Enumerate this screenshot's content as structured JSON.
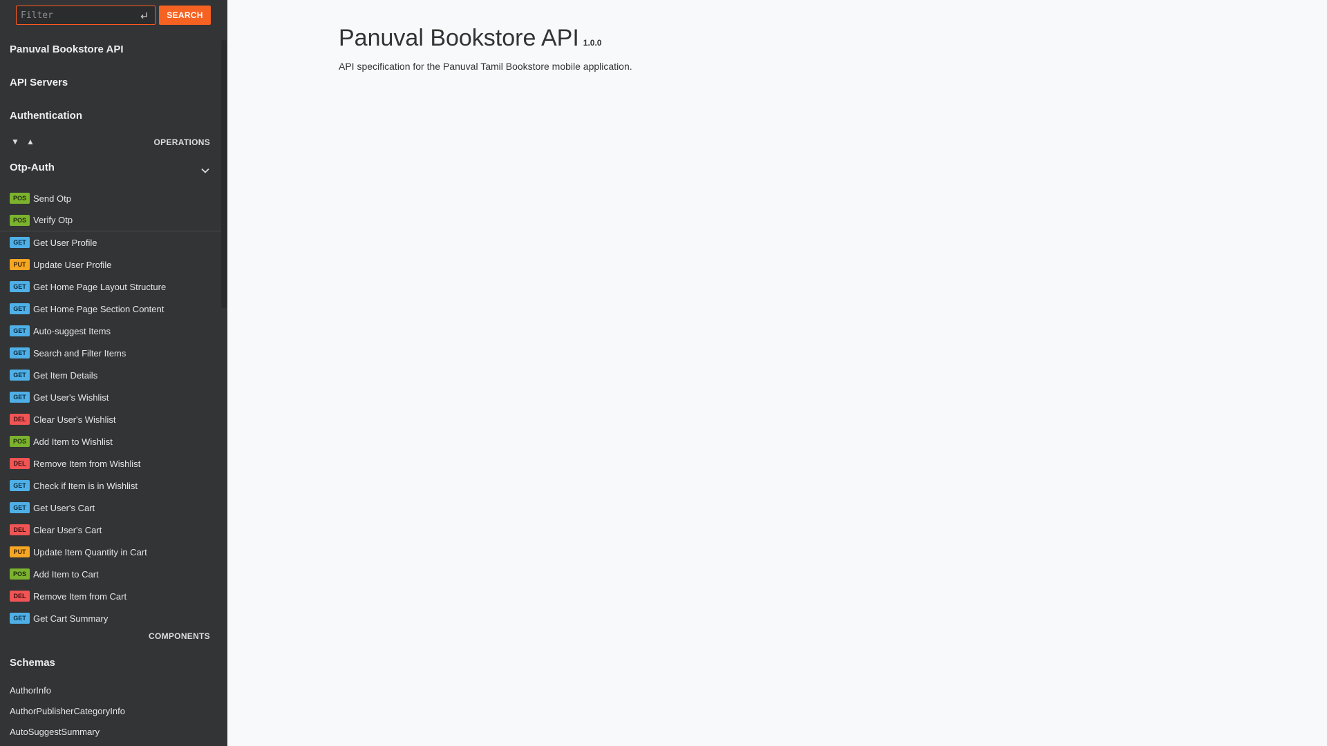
{
  "search": {
    "placeholder": "Filter",
    "button_label": "SEARCH"
  },
  "nav": {
    "api_title": "Panuval Bookstore API",
    "servers": "API Servers",
    "authentication": "Authentication",
    "operations_label": "OPERATIONS",
    "expand_all_symbol": "▼",
    "collapse_all_symbol": "▲",
    "group_name": "Otp-Auth",
    "operations": [
      {
        "method": "POS",
        "label": "Send Otp"
      },
      {
        "method": "POS",
        "label": "Verify Otp"
      },
      {
        "method": "GET",
        "label": "Get User Profile"
      },
      {
        "method": "PUT",
        "label": "Update User Profile"
      },
      {
        "method": "GET",
        "label": "Get Home Page Layout Structure"
      },
      {
        "method": "GET",
        "label": "Get Home Page Section Content"
      },
      {
        "method": "GET",
        "label": "Auto-suggest Items"
      },
      {
        "method": "GET",
        "label": "Search and Filter Items"
      },
      {
        "method": "GET",
        "label": "Get Item Details"
      },
      {
        "method": "GET",
        "label": "Get User's Wishlist"
      },
      {
        "method": "DEL",
        "label": "Clear User's Wishlist"
      },
      {
        "method": "POS",
        "label": "Add Item to Wishlist"
      },
      {
        "method": "DEL",
        "label": "Remove Item from Wishlist"
      },
      {
        "method": "GET",
        "label": "Check if Item is in Wishlist"
      },
      {
        "method": "GET",
        "label": "Get User's Cart"
      },
      {
        "method": "DEL",
        "label": "Clear User's Cart"
      },
      {
        "method": "PUT",
        "label": "Update Item Quantity in Cart"
      },
      {
        "method": "POS",
        "label": "Add Item to Cart"
      },
      {
        "method": "DEL",
        "label": "Remove Item from Cart"
      },
      {
        "method": "GET",
        "label": "Get Cart Summary"
      }
    ],
    "components_label": "COMPONENTS",
    "schemas_heading": "Schemas",
    "schemas": [
      "AuthorInfo",
      "AuthorPublisherCategoryInfo",
      "AutoSuggestSummary"
    ]
  },
  "main": {
    "title": "Panuval Bookstore API",
    "version": "1.0.0",
    "description": "API specification for the Panuval Tamil Bookstore mobile application."
  },
  "colors": {
    "accent": "#f56222",
    "sidebar_bg": "#333436",
    "main_bg": "#f8f9fa",
    "post": "#7bb32e",
    "get": "#4fb0e8",
    "put": "#f6a623",
    "delete": "#f05454"
  }
}
